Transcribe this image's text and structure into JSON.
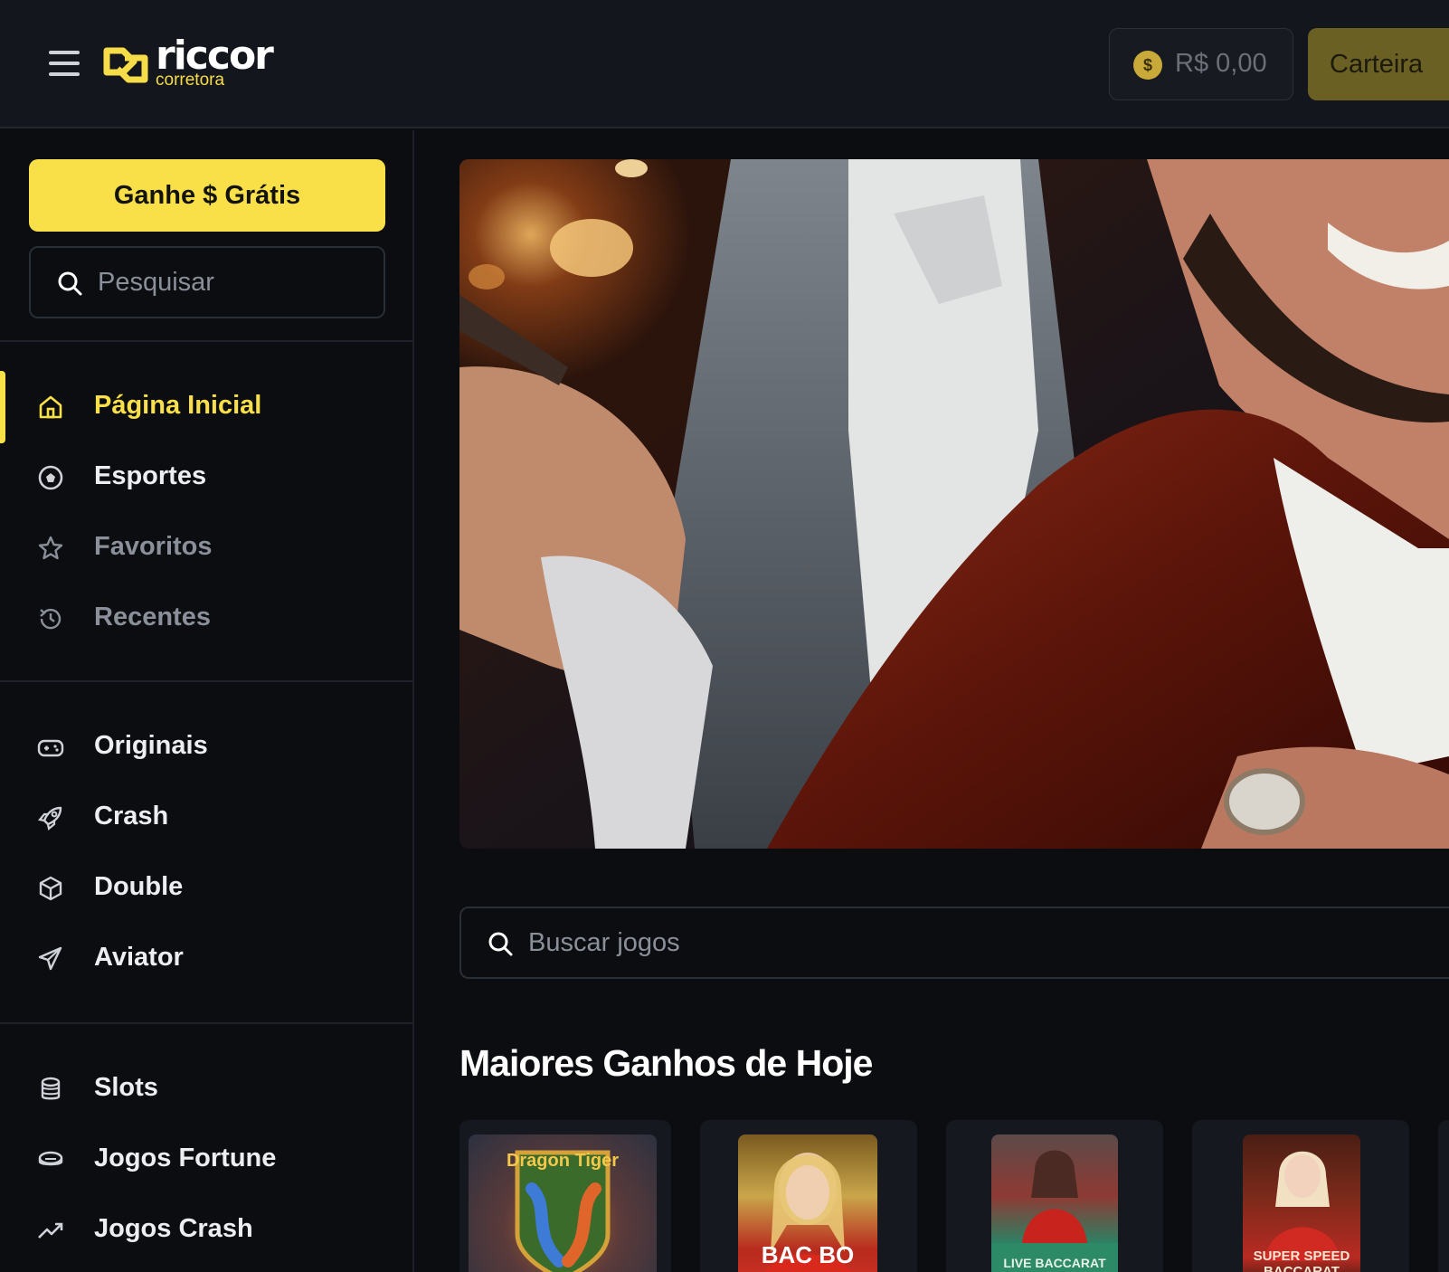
{
  "header": {
    "brand": "riccor",
    "brand_sub": "corretora",
    "balance": "R$ 0,00",
    "balance_icon": "$",
    "wallet_label": "Carteira"
  },
  "sidebar": {
    "bonus_label": "Ganhe $ Grátis",
    "search_placeholder": "Pesquisar",
    "primary": [
      {
        "label": "Página Inicial",
        "icon": "home-icon"
      },
      {
        "label": "Esportes",
        "icon": "soccer-ball-icon"
      },
      {
        "label": "Favoritos",
        "icon": "star-icon"
      },
      {
        "label": "Recentes",
        "icon": "history-icon"
      }
    ],
    "games": [
      {
        "label": "Originais",
        "icon": "gamepad-icon"
      },
      {
        "label": "Crash",
        "icon": "rocket-icon"
      },
      {
        "label": "Double",
        "icon": "cube-icon"
      },
      {
        "label": "Aviator",
        "icon": "paper-plane-icon"
      }
    ],
    "casino": [
      {
        "label": "Slots",
        "icon": "coin-stack-icon"
      },
      {
        "label": "Jogos Fortune",
        "icon": "chip-icon"
      },
      {
        "label": "Jogos Crash",
        "icon": "trending-up-icon"
      }
    ]
  },
  "main": {
    "search_placeholder": "Buscar jogos",
    "section_title": "Maiores Ganhos de Hoje",
    "game_cards": [
      {
        "title": "Dragon Tiger"
      },
      {
        "title": "BAC BO"
      },
      {
        "title": "LIVE BACCARAT"
      },
      {
        "title": "SUPER SPEED BACCARAT"
      }
    ]
  },
  "colors": {
    "accent": "#f9e048",
    "header_bg": "#13161c",
    "page_bg": "#0b0d10",
    "wallet_bg": "#6b6024"
  }
}
